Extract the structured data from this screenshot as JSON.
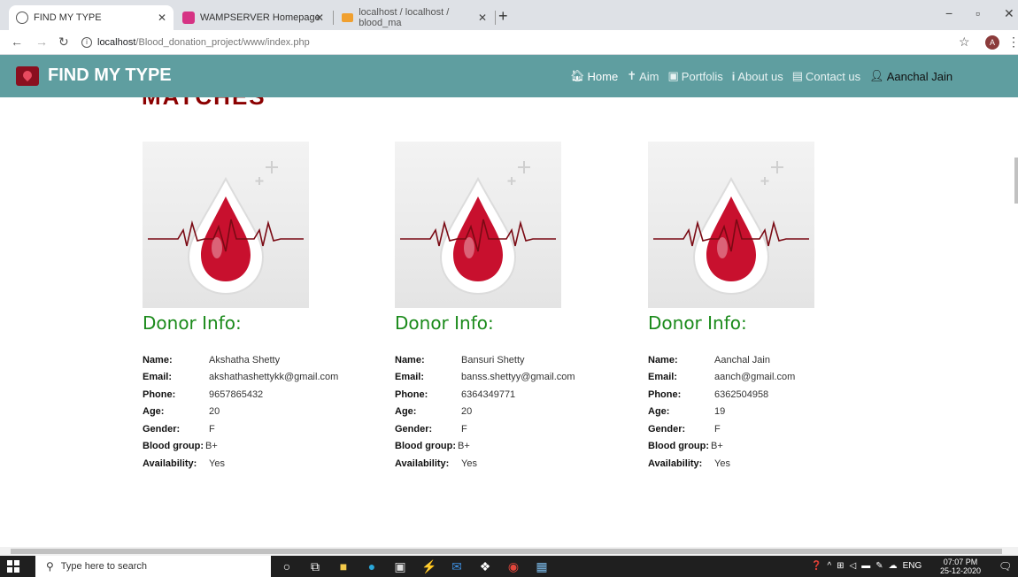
{
  "browser": {
    "tabs": [
      {
        "title": "FIND MY TYPE",
        "active": true
      },
      {
        "title": "WAMPSERVER Homepage",
        "active": false
      },
      {
        "title": "localhost / localhost / blood_ma",
        "active": false
      }
    ],
    "url_host": "localhost",
    "url_path": "/Blood_donation_project/www/index.php",
    "profile_initial": "A"
  },
  "navbar": {
    "brand": "FIND MY TYPE",
    "items": [
      {
        "label": "Home",
        "icon": "home-icon"
      },
      {
        "label": "Aim",
        "icon": "aim-icon"
      },
      {
        "label": "Portfolis",
        "icon": "image-icon"
      },
      {
        "label": "About us",
        "icon": "info-icon"
      },
      {
        "label": "Contact us",
        "icon": "contact-card-icon"
      },
      {
        "label": "Aanchal Jain",
        "icon": "user-icon"
      }
    ]
  },
  "page": {
    "partial_heading": "MATCHES"
  },
  "labels": {
    "donor_heading": "Donor Info:",
    "name": "Name:",
    "email": "Email:",
    "phone": "Phone:",
    "age": "Age:",
    "gender": "Gender:",
    "blood_group": "Blood group:",
    "availability": "Availability:"
  },
  "donors": [
    {
      "name": "Akshatha Shetty",
      "email": "akshathashettykk@gmail.com",
      "phone": "9657865432",
      "age": "20",
      "gender": "F",
      "blood_group": "B+",
      "availability": "Yes"
    },
    {
      "name": "Bansuri Shetty",
      "email": "banss.shettyy@gmail.com",
      "phone": "6364349771",
      "age": "20",
      "gender": "F",
      "blood_group": "B+",
      "availability": "Yes"
    },
    {
      "name": "Aanchal Jain",
      "email": "aanch@gmail.com",
      "phone": "6362504958",
      "age": "19",
      "gender": "F",
      "blood_group": "B+",
      "availability": "Yes"
    }
  ],
  "taskbar": {
    "search_placeholder": "Type here to search",
    "lang": "ENG",
    "time": "07:07 PM",
    "date": "25-12-2020"
  },
  "colors": {
    "navbar": "#5f9ea0",
    "heading_green": "#1a8a1a",
    "blood_red": "#c8102e"
  }
}
